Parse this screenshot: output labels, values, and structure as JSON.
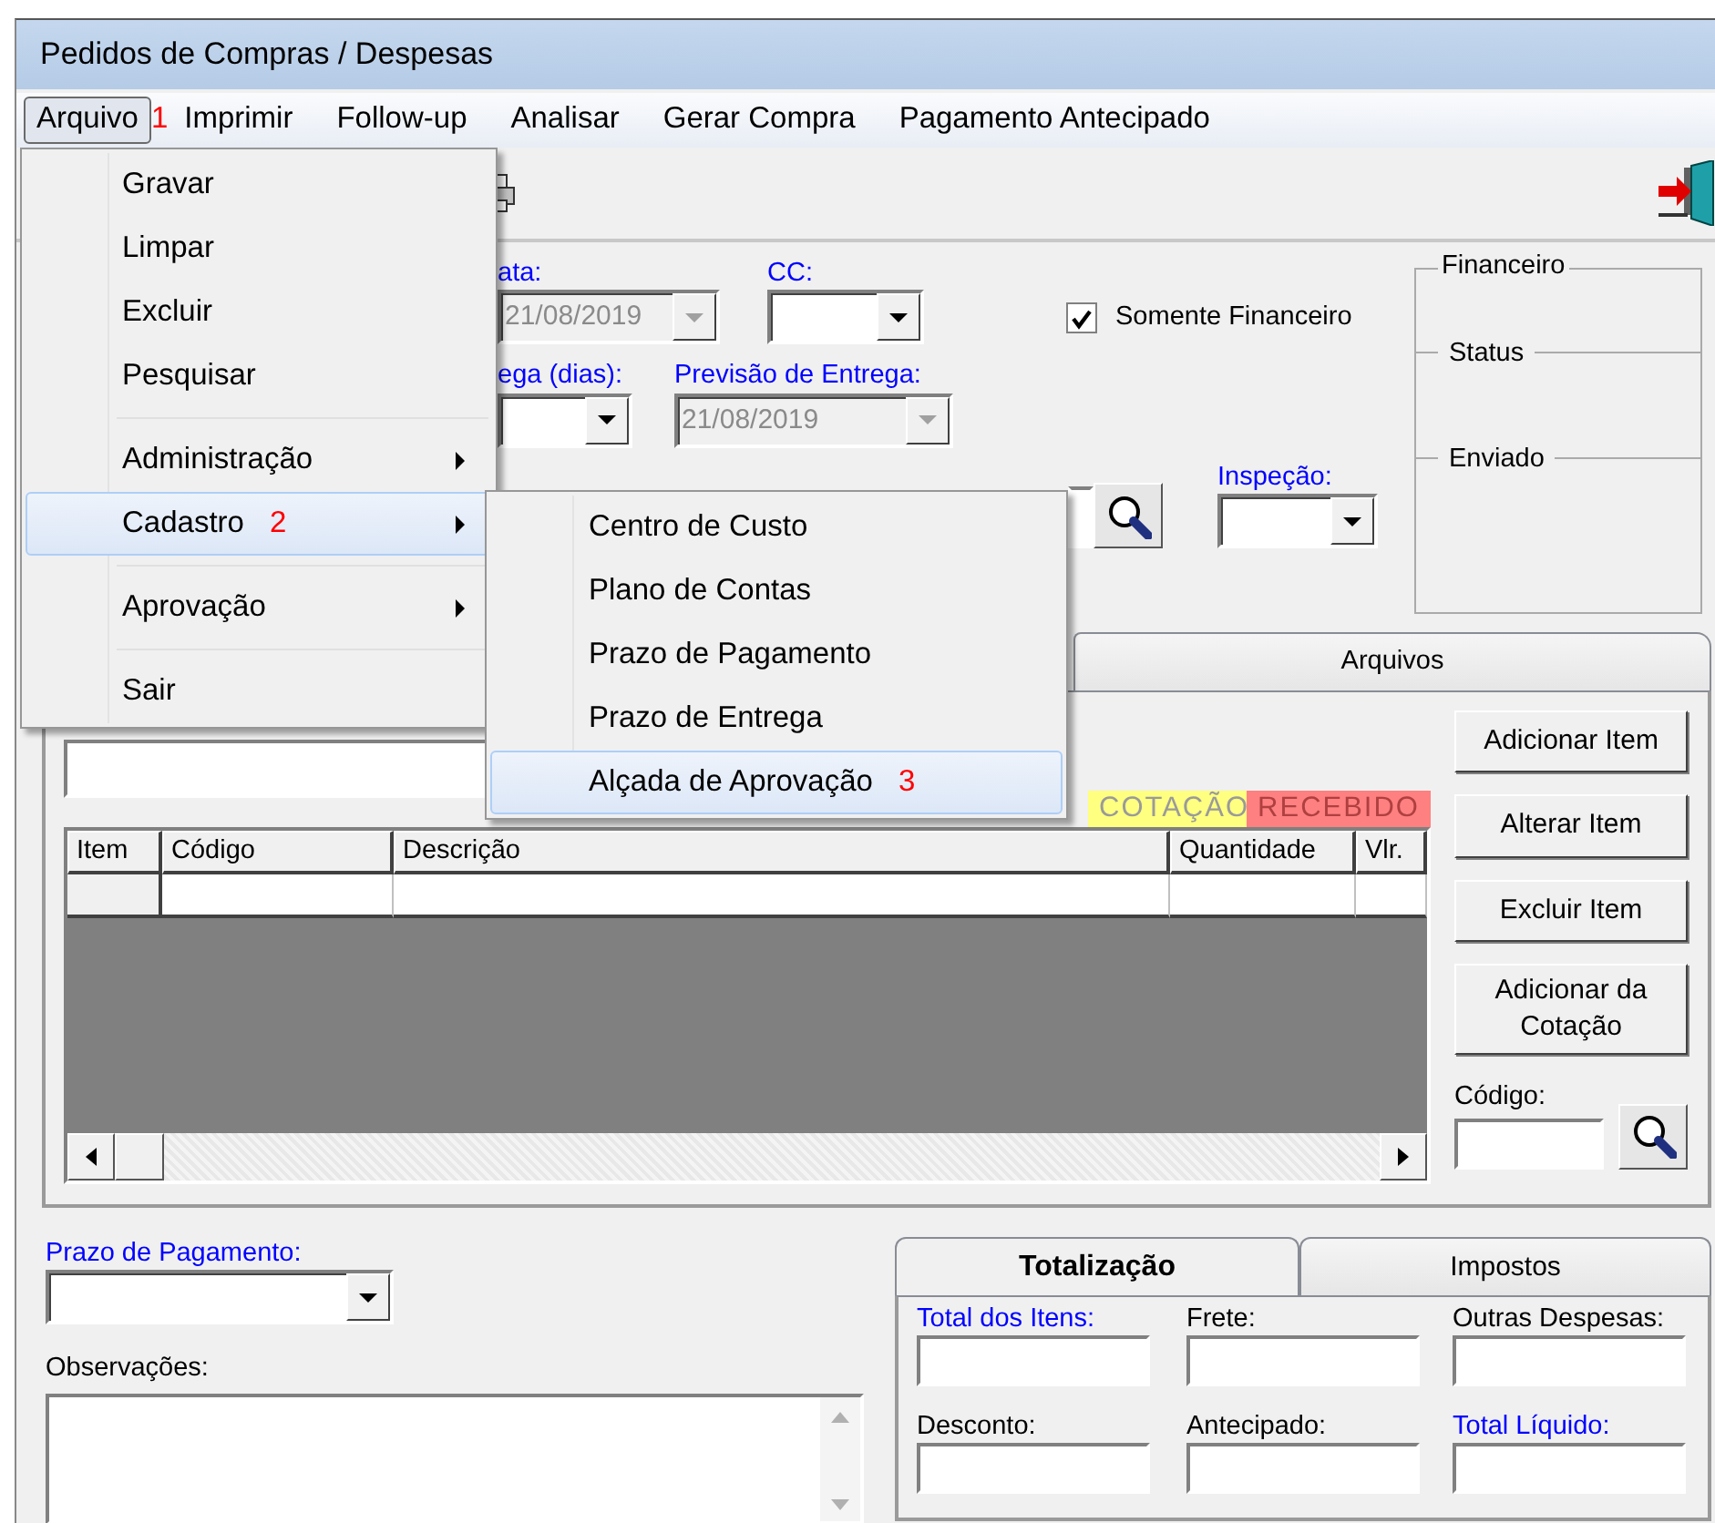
{
  "window": {
    "title": "Pedidos de Compras / Despesas"
  },
  "menu_bar": [
    {
      "label": "Arquivo",
      "selected": true,
      "annotation": "1"
    },
    {
      "label": "Imprimir",
      "selected": false
    },
    {
      "label": "Follow-up",
      "selected": false
    },
    {
      "label": "Analisar",
      "selected": false
    },
    {
      "label": "Gerar Compra",
      "selected": false
    },
    {
      "label": "Pagamento Antecipado",
      "selected": false
    }
  ],
  "file_menu": [
    {
      "kind": "item",
      "label": "Gravar",
      "selected": false
    },
    {
      "kind": "item",
      "label": "Limpar",
      "selected": false
    },
    {
      "kind": "item",
      "label": "Excluir",
      "selected": false
    },
    {
      "kind": "item",
      "label": "Pesquisar",
      "selected": false
    },
    {
      "kind": "separator"
    },
    {
      "kind": "submenu",
      "label": "Administração",
      "selected": false
    },
    {
      "kind": "submenu",
      "label": "Cadastro",
      "selected": true,
      "annotation": "2"
    },
    {
      "kind": "separator"
    },
    {
      "kind": "submenu",
      "label": "Aprovação",
      "selected": false
    },
    {
      "kind": "separator"
    },
    {
      "kind": "item",
      "label": "Sair",
      "selected": false
    }
  ],
  "cadastro_submenu": [
    {
      "label": "Centro de Custo",
      "selected": false
    },
    {
      "label": "Plano de Contas",
      "selected": false
    },
    {
      "label": "Prazo de Pagamento",
      "selected": false
    },
    {
      "label": "Prazo de Entrega",
      "selected": false
    },
    {
      "label": "Alçada de Aprovação",
      "selected": true,
      "annotation": "3"
    }
  ],
  "form": {
    "data": {
      "label": "ata:",
      "required": true,
      "value": "21/08/2019",
      "disabled": true
    },
    "cc": {
      "label": "CC:",
      "required": true,
      "disabled": false
    },
    "somente_financeiro": {
      "label": "Somente Financeiro",
      "checked": true
    },
    "prazo_entrega": {
      "label": "ega (dias):",
      "required": true,
      "disabled": false
    },
    "previsao_entrega": {
      "label": "Previsão de Entrega:",
      "required": true,
      "value": "21/08/2019",
      "disabled": true
    },
    "inspecao": {
      "label": "Inspeção:",
      "required": true,
      "disabled": false
    }
  },
  "financeiro_group": {
    "title": "Financeiro",
    "sections": [
      "Status",
      "Enviado"
    ]
  },
  "tabs": [
    {
      "label": "Arquivos",
      "selected": false
    }
  ],
  "status_legend": [
    {
      "label": "COTAÇÃO",
      "color": "#ffff80"
    },
    {
      "label": "RECEBIDO",
      "color": "#ff8080"
    }
  ],
  "grid": {
    "columns": [
      "Item",
      "Código",
      "Descrição",
      "Quantidade",
      "Vlr."
    ]
  },
  "item_buttons": [
    "Adicionar Item",
    "Alterar Item",
    "Excluir Item",
    "Adicionar da Cotação"
  ],
  "codigo_label": "Código:",
  "prazo_pagamento": {
    "label": "Prazo de Pagamento:",
    "required": true
  },
  "observacoes": {
    "label": "Observações:",
    "required": false
  },
  "totals_tabs": [
    {
      "label": "Totalização",
      "selected": true
    },
    {
      "label": "Impostos",
      "selected": false
    }
  ],
  "totals_fields": [
    {
      "label": "Total dos Itens:",
      "required": true
    },
    {
      "label": "Frete:",
      "required": false
    },
    {
      "label": "Outras Despesas:",
      "required": false
    },
    {
      "label": "Desconto:",
      "required": false
    },
    {
      "label": "Antecipado:",
      "required": false
    },
    {
      "label": "Total Líquido:",
      "required": true
    }
  ]
}
